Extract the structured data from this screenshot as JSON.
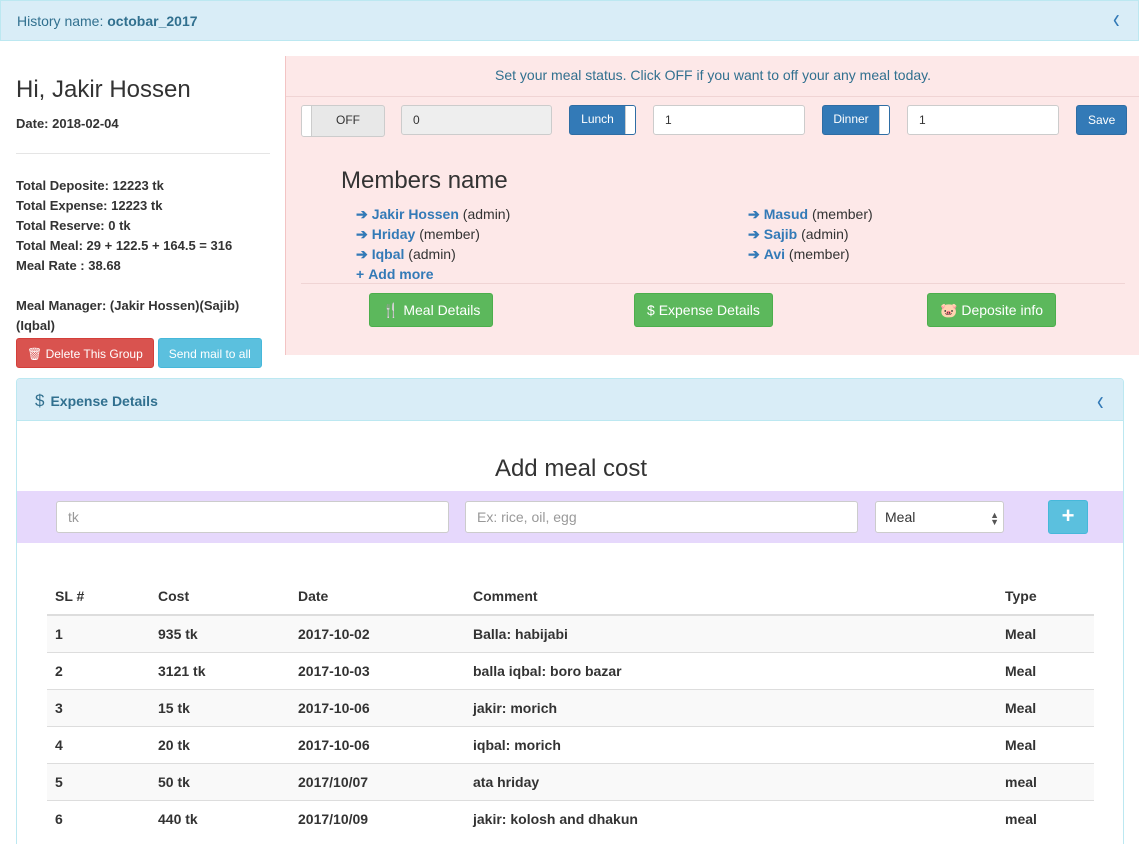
{
  "history": {
    "label": "History name:",
    "name": "octobar_2017"
  },
  "user": {
    "greeting": "Hi, Jakir Hossen",
    "date": "Date: 2018-02-04",
    "stats": [
      "Total Deposite: 12223 tk",
      "Total Expense: 12223 tk",
      "Total Reserve: 0 tk",
      "Total Meal: 29 + 122.5 + 164.5 = 316",
      "Meal Rate : 38.68"
    ],
    "meal_manager": "Meal Manager: (Jakir Hossen)(Sajib) (Iqbal)",
    "delete_label": "Delete This Group",
    "send_mail_label": "Send mail to all"
  },
  "meal_status": {
    "message": "Set your meal status. Click OFF if you want to off your any meal today.",
    "off_label": "OFF",
    "off_value": "0",
    "lunch_label": "Lunch",
    "lunch_value": "1",
    "dinner_label": "Dinner",
    "dinner_value": "1",
    "save_label": "Save"
  },
  "members": {
    "title": "Members name",
    "list": [
      {
        "name": "Jakir Hossen",
        "role": "(admin)"
      },
      {
        "name": "Hriday",
        "role": "(member)"
      },
      {
        "name": "Iqbal",
        "role": "(admin)"
      },
      {
        "name": "Masud",
        "role": "(member)"
      },
      {
        "name": "Sajib",
        "role": "(admin)"
      },
      {
        "name": "Avi",
        "role": "(member)"
      }
    ],
    "add_more": "Add more"
  },
  "actions": {
    "meal_details": "Meal Details",
    "expense_details": "Expense Details",
    "deposite_info": "Deposite info"
  },
  "expense_panel": {
    "title": "Expense Details",
    "add_title": "Add meal cost",
    "tk_placeholder": "tk",
    "comment_placeholder": "Ex: rice, oil, egg",
    "type_selected": "Meal",
    "add_button": "+"
  },
  "table": {
    "headers": [
      "SL #",
      "Cost",
      "Date",
      "Comment",
      "Type"
    ],
    "rows": [
      [
        "1",
        "935 tk",
        "2017-10-02",
        "Balla: habijabi",
        "Meal"
      ],
      [
        "2",
        "3121 tk",
        "2017-10-03",
        "balla iqbal: boro bazar",
        "Meal"
      ],
      [
        "3",
        "15 tk",
        "2017-10-06",
        "jakir: morich",
        "Meal"
      ],
      [
        "4",
        "20 tk",
        "2017-10-06",
        "iqbal: morich",
        "Meal"
      ],
      [
        "5",
        "50 tk",
        "2017/10/07",
        "ata hriday",
        "meal"
      ],
      [
        "6",
        "440 tk",
        "2017/10/09",
        "jakir: kolosh and dhakun",
        "meal"
      ]
    ]
  }
}
